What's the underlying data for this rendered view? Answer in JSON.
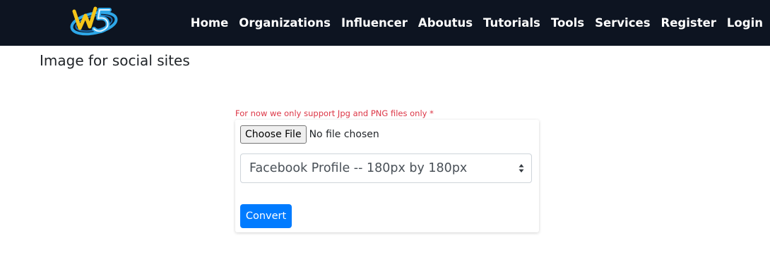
{
  "nav": {
    "logo_alt": "W5",
    "links": [
      "Home",
      "Organizations",
      "Influencer",
      "Aboutus",
      "Tutorials",
      "Tools",
      "Services",
      "Register",
      "Login"
    ]
  },
  "page": {
    "title": "Image for social sites"
  },
  "form": {
    "note": "For now we only support Jpg and PNG files only *",
    "choose_file_label": "Choose File",
    "file_status": "No file chosen",
    "size_select_value": "Facebook Profile -- 180px by 180px",
    "convert_label": "Convert"
  },
  "colors": {
    "navbar_bg": "#0d1421",
    "note_red": "#dc3545",
    "primary_blue": "#007bff",
    "logo_blue": "#2ea7e8",
    "logo_yellow": "#f5c518"
  }
}
